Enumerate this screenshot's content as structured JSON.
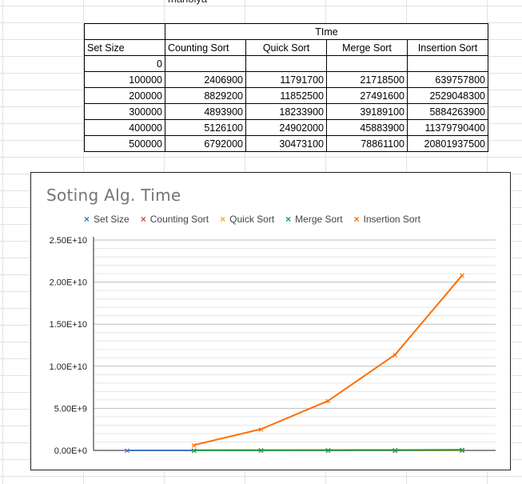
{
  "sheet": {
    "cut_text": "manolya",
    "header_group": "TIme",
    "columns": [
      "Set Size",
      "Counting Sort",
      "Quick Sort",
      "Merge Sort",
      "Insertion Sort"
    ],
    "rows": [
      [
        "0",
        "",
        "",
        "",
        ""
      ],
      [
        "100000",
        "2406900",
        "11791700",
        "21718500",
        "639757800"
      ],
      [
        "200000",
        "8829200",
        "11852500",
        "27491600",
        "2529048300"
      ],
      [
        "300000",
        "4893900",
        "18233900",
        "39189100",
        "5884263900"
      ],
      [
        "400000",
        "5126100",
        "24902000",
        "45883900",
        "11379790400"
      ],
      [
        "500000",
        "6792000",
        "30473100",
        "78861100",
        "20801937500"
      ]
    ]
  },
  "chart_data": {
    "type": "line",
    "title": "Soting Alg. Time",
    "xlabel": "",
    "ylabel": "",
    "ylim": [
      0,
      25000000000
    ],
    "yticks": [
      "0.00E+0",
      "5.00E+9",
      "1.00E+10",
      "1.50E+10",
      "2.00E+10",
      "2.50E+10"
    ],
    "grid": true,
    "legend_position": "top",
    "series": [
      {
        "name": "Set Size",
        "color": "#4472c4",
        "values": [
          0,
          100000,
          200000,
          300000,
          400000,
          500000
        ]
      },
      {
        "name": "Counting Sort",
        "color": "#db4437",
        "values": [
          null,
          2406900,
          8829200,
          4893900,
          5126100,
          6792000
        ]
      },
      {
        "name": "Quick Sort",
        "color": "#f4b400",
        "values": [
          null,
          11791700,
          11852500,
          18233900,
          24902000,
          30473100
        ]
      },
      {
        "name": "Merge Sort",
        "color": "#0f9d58",
        "values": [
          null,
          21718500,
          27491600,
          39189100,
          45883900,
          78861100
        ]
      },
      {
        "name": "Insertion Sort",
        "color": "#ff6d01",
        "values": [
          null,
          639757800,
          2529048300,
          5884263900,
          11379790400,
          20801937500
        ]
      }
    ]
  }
}
